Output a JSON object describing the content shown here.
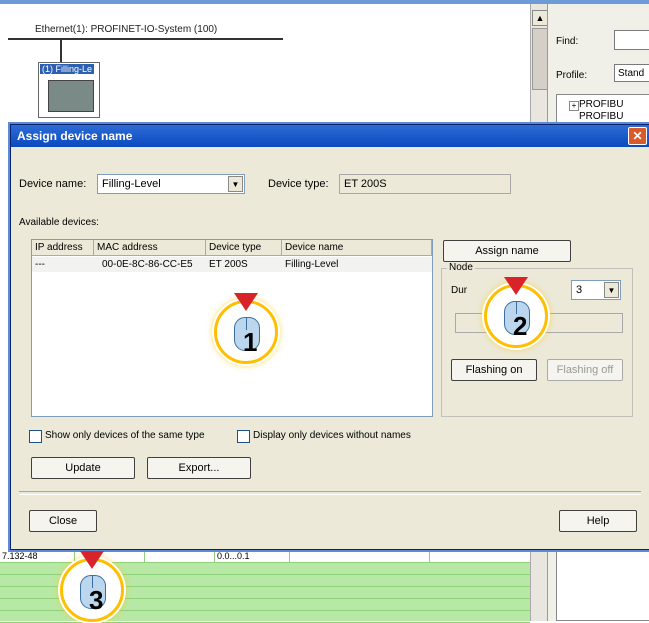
{
  "network": {
    "ethernet_label": "Ethernet(1): PROFINET-IO-System (100)",
    "device_label": "(1) Filling-Le"
  },
  "catalog": {
    "find_label": "Find:",
    "profile_label": "Profile:",
    "profile_value": "Stand",
    "tree_items": [
      "PROFIBU",
      "PROFIBU"
    ]
  },
  "bottom_table": {
    "ip_partial": "7.132-48",
    "address": "0.0...0.1"
  },
  "dialog": {
    "title": "Assign device name",
    "device_name_label": "Device name:",
    "device_name_value": "Filling-Level",
    "device_type_label": "Device type:",
    "device_type_value": "ET 200S",
    "available_label": "Available devices:",
    "columns": [
      "IP address",
      "MAC address",
      "Device type",
      "Device name"
    ],
    "rows": [
      {
        "ip": "---",
        "mac": "00-0E-8C-86-CC-E5",
        "type": "ET 200S",
        "name": "Filling-Level"
      }
    ],
    "assign_button": "Assign name",
    "node_group_label": "Node",
    "duration_label": "Dur",
    "duration_value": "3",
    "flashing_on": "Flashing on",
    "flashing_off": "Flashing off",
    "show_same_type": "Show only devices of the same type",
    "display_without_names": "Display only devices without names",
    "update_button": "Update",
    "export_button": "Export...",
    "close_button": "Close",
    "help_button": "Help"
  },
  "callouts": [
    "1",
    "2",
    "3"
  ],
  "colors": {
    "title_bar": "#0a4ac0",
    "callout_ring": "#ffbf00",
    "arrow": "#d8232a",
    "table_green": "#b8e8a6"
  }
}
